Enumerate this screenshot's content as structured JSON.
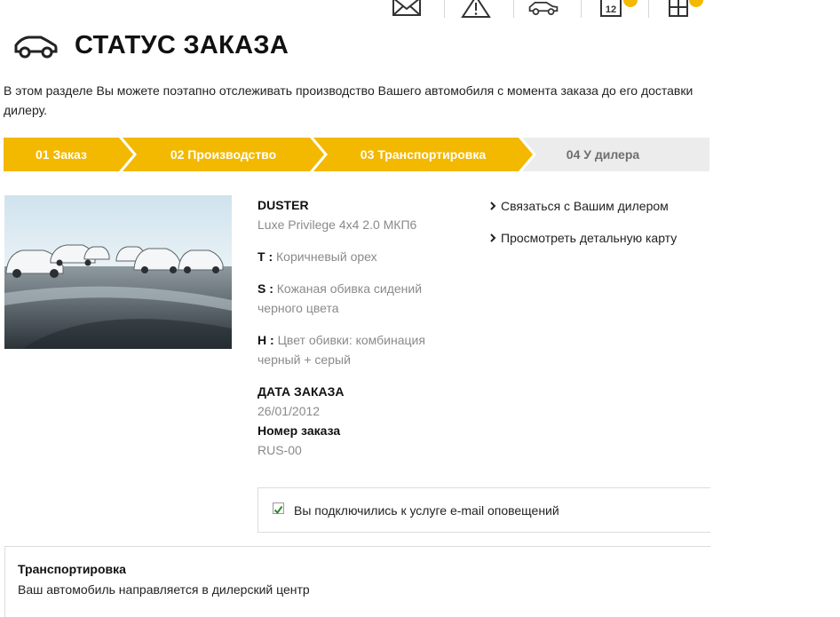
{
  "header": {
    "title": "СТАТУС ЗАКАЗА",
    "intro": "В этом разделе Вы можете поэтапно отслеживать производство Вашего автомобиля с момента заказа до его доставки дилеру."
  },
  "topbar": {
    "icons": [
      "mail-icon",
      "warning-icon",
      "car-icon",
      "calendar-icon",
      "grid-icon"
    ],
    "calendar_text": "12",
    "badge_color": "#f3b800"
  },
  "steps": [
    {
      "label": "01 Заказ",
      "state": "done"
    },
    {
      "label": "02 Производство",
      "state": "done"
    },
    {
      "label": "03 Транспортировка",
      "state": "current"
    },
    {
      "label": "04 У дилера",
      "state": "pending"
    }
  ],
  "colors": {
    "accent": "#f3b800",
    "inactive": "#ececec"
  },
  "order": {
    "model": "DUSTER",
    "version": "Luxe Privilege 4x4 2.0 МКП6",
    "options": [
      {
        "key": "T :",
        "value": "Коричневый орех"
      },
      {
        "key": "S :",
        "value": "Кожаная обивка сидений черного цвета"
      },
      {
        "key": "H :",
        "value": "Цвет обивки: комбинация черный + серый"
      }
    ],
    "date_label": "ДАТА ЗАКАЗА",
    "date_value": "26/01/2012",
    "number_label": "Номер заказа",
    "number_value": "RUS-00"
  },
  "links": [
    "Связаться с Вашим дилером",
    "Просмотреть детальную карту"
  ],
  "notification": {
    "checked": true,
    "text": "Вы подключились к услуге e-mail оповещений"
  },
  "transport": {
    "title": "Транспортировка",
    "text": "Ваш автомобиль направляется в дилерский центр"
  }
}
